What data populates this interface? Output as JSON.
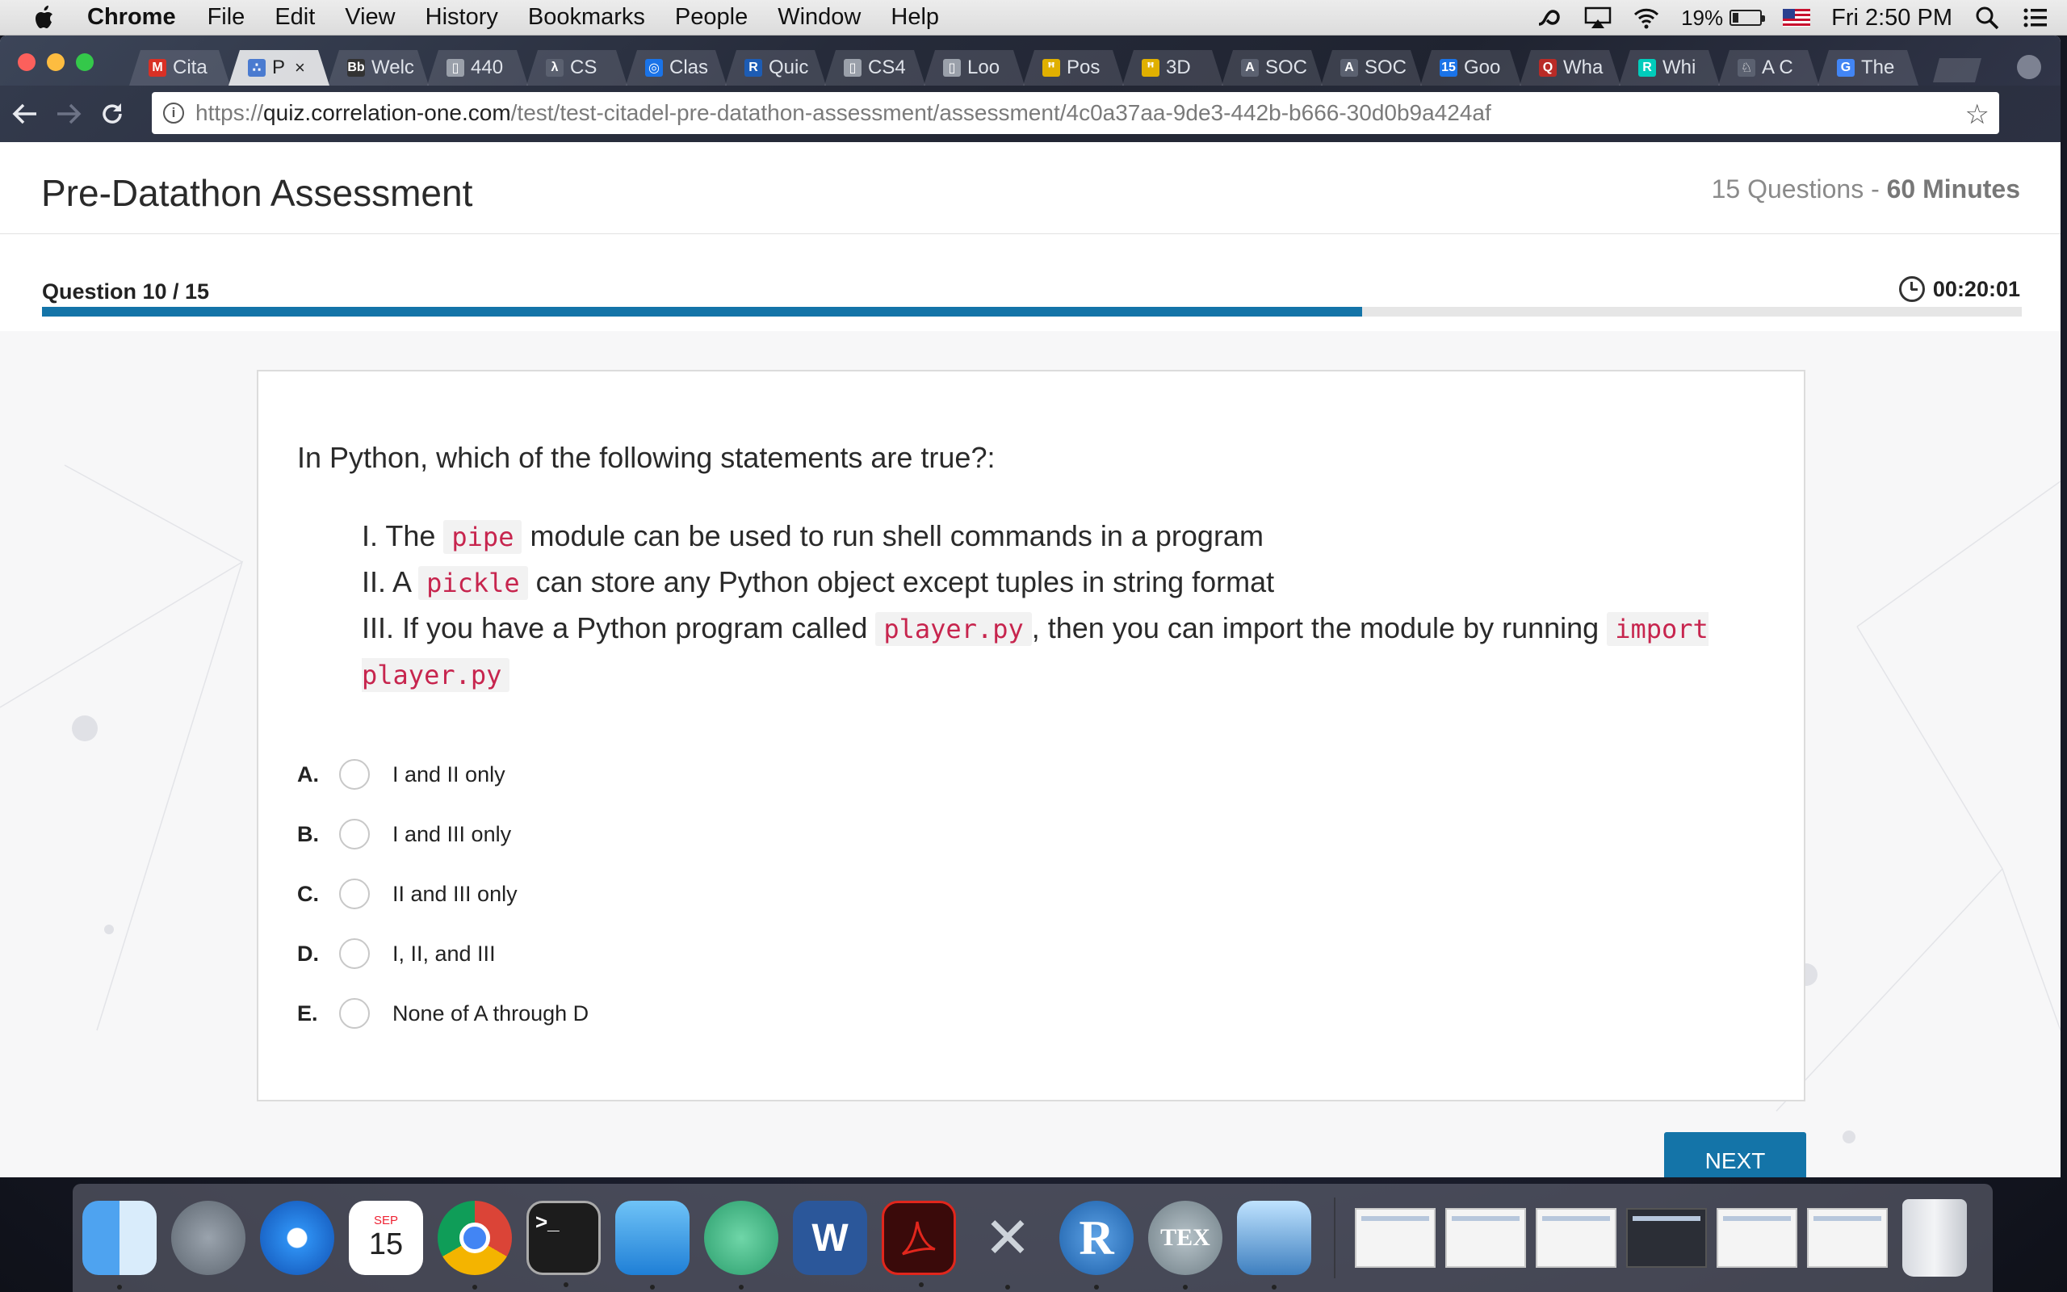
{
  "menubar": {
    "app_name": "Chrome",
    "menus": [
      "File",
      "Edit",
      "View",
      "History",
      "Bookmarks",
      "People",
      "Window",
      "Help"
    ],
    "battery_percent": "19%",
    "battery_level": 0.19,
    "clock": "Fri 2:50 PM"
  },
  "browser": {
    "tabs": [
      {
        "title": "Cita",
        "icon": "gmail-icon",
        "color": "#d93025",
        "glyph": "M"
      },
      {
        "title": "P",
        "icon": "network-icon",
        "color": "#4a7bd0",
        "glyph": "∴",
        "active": true
      },
      {
        "title": "Welc",
        "icon": "blackboard-icon",
        "color": "#333333",
        "glyph": "Bb"
      },
      {
        "title": "440",
        "icon": "document-icon",
        "color": "#9aa0aa",
        "glyph": "▯"
      },
      {
        "title": "CS",
        "icon": "lambda-icon",
        "color": "#5b6170",
        "glyph": "λ"
      },
      {
        "title": "Clas",
        "icon": "classroom-icon",
        "color": "#1a73e8",
        "glyph": "◎"
      },
      {
        "title": "Quic",
        "icon": "r-icon",
        "color": "#1d5cb4",
        "glyph": "R"
      },
      {
        "title": "CS4",
        "icon": "document-icon",
        "color": "#9aa0aa",
        "glyph": "▯"
      },
      {
        "title": "Loo",
        "icon": "document-icon",
        "color": "#9aa0aa",
        "glyph": "▯"
      },
      {
        "title": "Pos",
        "icon": "binoculars-icon",
        "color": "#e0b000",
        "glyph": "ꟸ"
      },
      {
        "title": "3D",
        "icon": "binoculars-icon",
        "color": "#e0b000",
        "glyph": "ꟸ"
      },
      {
        "title": "SOC",
        "icon": "soc-icon",
        "color": "#5b6170",
        "glyph": "A"
      },
      {
        "title": "SOC",
        "icon": "soc-icon",
        "color": "#5b6170",
        "glyph": "A"
      },
      {
        "title": "Goo",
        "icon": "calendar-icon",
        "color": "#1a73e8",
        "glyph": "15"
      },
      {
        "title": "Wha",
        "icon": "quora-icon",
        "color": "#b92b27",
        "glyph": "Q"
      },
      {
        "title": "Whi",
        "icon": "rg-icon",
        "color": "#00ccbb",
        "glyph": "R"
      },
      {
        "title": "A C",
        "icon": "chess-icon",
        "color": "#5b6170",
        "glyph": "♘"
      },
      {
        "title": "The",
        "icon": "google-icon",
        "color": "#4285f4",
        "glyph": "G"
      }
    ],
    "url_scheme": "https://",
    "url_host": "quiz.correlation-one.com",
    "url_path": "/test/test-citadel-pre-datathon-assessment/assessment/4c0a37aa-9de3-442b-b666-30d0b9a424af"
  },
  "quiz": {
    "title": "Pre-Datathon Assessment",
    "questions_label": "15 Questions - ",
    "duration_label": "60 Minutes",
    "question_counter": "Question 10 / 15",
    "timer": "00:20:01",
    "progress_fraction": 0.667,
    "question_text": "In Python, which of the following statements are true?:",
    "statements": [
      {
        "pre": "I. The ",
        "code1": "pipe",
        "mid": " module can be used to run shell commands in a program"
      },
      {
        "pre": "II. A ",
        "code1": "pickle",
        "mid": " can store any Python object except tuples in string format"
      },
      {
        "pre": "III. If you have a Python program called ",
        "code1": "player.py",
        "mid": ", then you can import the module by running ",
        "code2": "import player.py"
      }
    ],
    "choices": [
      {
        "letter": "A.",
        "text": "I and II only"
      },
      {
        "letter": "B.",
        "text": "I and III only"
      },
      {
        "letter": "C.",
        "text": "II and III only"
      },
      {
        "letter": "D.",
        "text": "I, II, and III"
      },
      {
        "letter": "E.",
        "text": "None of A through D"
      }
    ],
    "next_label": "NEXT",
    "accent_color": "#1474a8"
  },
  "dock": {
    "calendar_month": "SEP",
    "calendar_day": "15",
    "terminal_prompt": ">_",
    "word_glyph": "W",
    "r_glyph": "R",
    "tex_glyph": "TEX"
  }
}
